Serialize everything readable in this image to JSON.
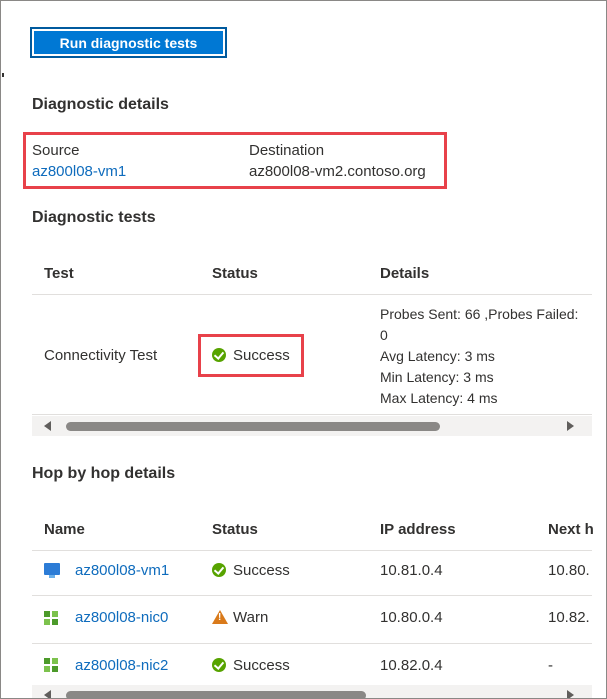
{
  "toolbar": {
    "run_label": "Run diagnostic tests"
  },
  "diagnostic_details": {
    "title": "Diagnostic details",
    "source_label": "Source",
    "source_value": "az800l08-vm1",
    "destination_label": "Destination",
    "destination_value": "az800l08-vm2.contoso.org"
  },
  "diagnostic_tests": {
    "title": "Diagnostic tests",
    "columns": [
      "Test",
      "Status",
      "Details"
    ],
    "rows": [
      {
        "test": "Connectivity Test",
        "status": "Success",
        "details": [
          "Probes Sent: 66 ,Probes Failed:",
          "0",
          "Avg Latency: 3 ms",
          "Min Latency: 3 ms",
          "Max Latency: 4 ms"
        ]
      }
    ]
  },
  "hop_by_hop": {
    "title": "Hop by hop details",
    "columns": [
      "Name",
      "Status",
      "IP address",
      "Next h"
    ],
    "rows": [
      {
        "name": "az800l08-vm1",
        "icon": "vm-icon",
        "status": "Success",
        "status_icon": "success-icon",
        "ip": "10.81.0.4",
        "next": "10.80."
      },
      {
        "name": "az800l08-nic0",
        "icon": "nic-icon",
        "status": "Warn",
        "status_icon": "warning-icon",
        "ip": "10.80.0.4",
        "next": "10.82."
      },
      {
        "name": "az800l08-nic2",
        "icon": "nic-icon",
        "status": "Success",
        "status_icon": "success-icon",
        "ip": "10.82.0.4",
        "next": "-"
      }
    ]
  },
  "colors": {
    "accent": "#0078d4",
    "link": "#0f6cbd",
    "highlight": "#e8414a",
    "success": "#57a300",
    "warning": "#d97a1a"
  }
}
